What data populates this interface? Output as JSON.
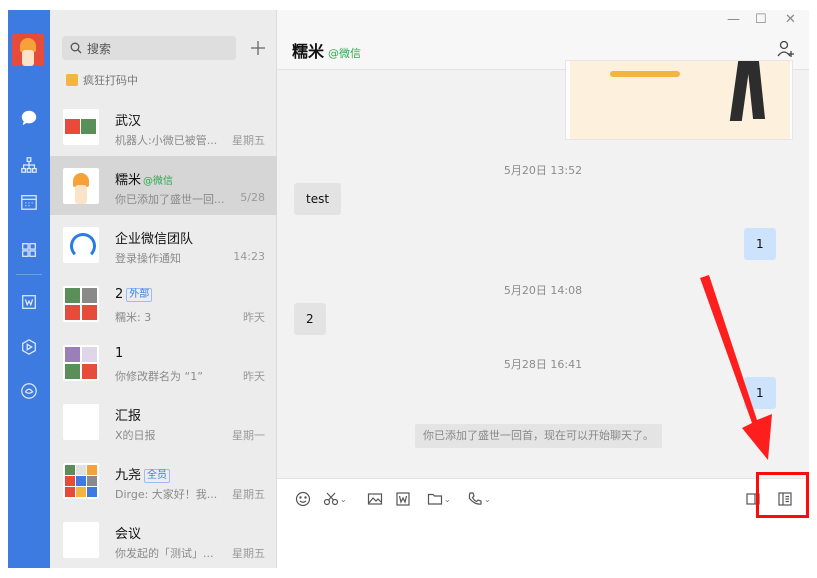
{
  "sidebar_list": {
    "search_placeholder": "搜索",
    "status_text": "疯狂打码中",
    "items": [
      {
        "name": "武汉",
        "tag": "",
        "tag_style": "",
        "preview": "机器人:小微已被管...",
        "time": "星期五"
      },
      {
        "name": "糯米",
        "tag": "@微信",
        "tag_style": "green",
        "preview": "你已添加了盛世一回...",
        "time": "5/28"
      },
      {
        "name": "企业微信团队",
        "tag": "",
        "tag_style": "",
        "preview": "登录操作通知",
        "time": "14:23"
      },
      {
        "name": "2",
        "tag": "外部",
        "tag_style": "box",
        "preview": "糯米: 3",
        "time": "昨天"
      },
      {
        "name": "1",
        "tag": "",
        "tag_style": "",
        "preview": "你修改群名为 “1”",
        "time": "昨天"
      },
      {
        "name": "汇报",
        "tag": "",
        "tag_style": "",
        "preview": "X的日报",
        "time": "星期一"
      },
      {
        "name": "九尧",
        "tag": "全员",
        "tag_style": "box",
        "preview": "Dirge: 大家好！我...",
        "time": "星期五"
      },
      {
        "name": "会议",
        "tag": "",
        "tag_style": "",
        "preview": "你发起的「测试」...",
        "time": "星期五"
      }
    ]
  },
  "chat": {
    "title": "糯米",
    "title_tag": "@微信",
    "window_controls": {
      "minimize": "—",
      "maximize": "☐",
      "close": "✕"
    },
    "timestamps": [
      "5月20日 13:52",
      "5月20日 14:08",
      "5月28日 16:41"
    ],
    "messages": [
      {
        "side": "in",
        "text": "test"
      },
      {
        "side": "out",
        "text": "1"
      },
      {
        "side": "in",
        "text": "2"
      },
      {
        "side": "out",
        "text": "1"
      }
    ],
    "system_notice": "你已添加了盛世一回首，现在可以开始聊天了。"
  },
  "colors": {
    "rail": "#3d7be0",
    "annotation_red": "#ff0a0a",
    "green_tag": "#2fa74e",
    "out_bubble": "#cde3fb"
  },
  "icons": {
    "rail": [
      "chat-icon",
      "org-icon",
      "calendar-icon",
      "apps-icon",
      "doc-icon",
      "hexagon-icon",
      "cloud-icon"
    ],
    "toolbar": [
      "emoji-icon",
      "scissors-icon",
      "image-icon",
      "word-icon",
      "folder-icon",
      "phone-icon",
      "screen-share-icon",
      "sidebar-panel-icon"
    ]
  }
}
